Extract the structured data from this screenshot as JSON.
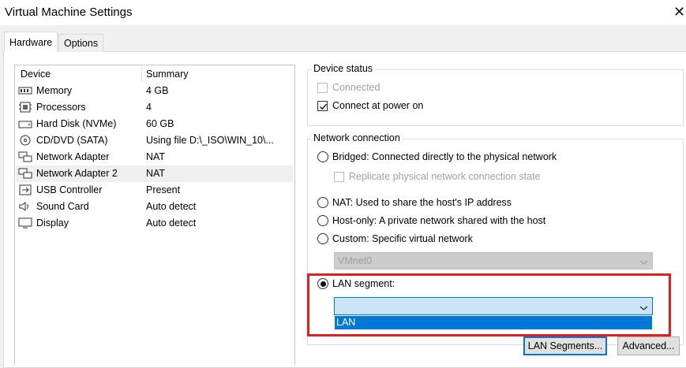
{
  "window": {
    "title": "Virtual Machine Settings",
    "close_glyph": "✕"
  },
  "tabs": [
    {
      "label": "Hardware",
      "active": true
    },
    {
      "label": "Options",
      "active": false
    }
  ],
  "device_list": {
    "headers": {
      "device": "Device",
      "summary": "Summary"
    },
    "items": [
      {
        "device": "Memory",
        "summary": "4 GB",
        "icon": "memory-icon"
      },
      {
        "device": "Processors",
        "summary": "4",
        "icon": "processor-icon"
      },
      {
        "device": "Hard Disk (NVMe)",
        "summary": "60 GB",
        "icon": "hard-disk-icon"
      },
      {
        "device": "CD/DVD (SATA)",
        "summary": "Using file D:\\_ISO\\WIN_10\\...",
        "icon": "cd-dvd-icon"
      },
      {
        "device": "Network Adapter",
        "summary": "NAT",
        "icon": "network-adapter-icon"
      },
      {
        "device": "Network Adapter 2",
        "summary": "NAT",
        "icon": "network-adapter-icon",
        "selected": true
      },
      {
        "device": "USB Controller",
        "summary": "Present",
        "icon": "usb-icon"
      },
      {
        "device": "Sound Card",
        "summary": "Auto detect",
        "icon": "speaker-icon"
      },
      {
        "device": "Display",
        "summary": "Auto detect",
        "icon": "monitor-icon"
      }
    ]
  },
  "device_status": {
    "title": "Device status",
    "connected": {
      "label": "Connected",
      "checked": false,
      "enabled": false
    },
    "connect_at_power_on": {
      "label": "Connect at power on",
      "checked": true,
      "enabled": true
    }
  },
  "network_connection": {
    "title": "Network connection",
    "bridged": {
      "label": "Bridged: Connected directly to the physical network",
      "selected": false
    },
    "replicate": {
      "label": "Replicate physical network connection state",
      "checked": false,
      "enabled": false
    },
    "nat": {
      "label": "NAT: Used to share the host's IP address",
      "selected": false
    },
    "host_only": {
      "label": "Host-only: A private network shared with the host",
      "selected": false
    },
    "custom": {
      "label": "Custom: Specific virtual network",
      "selected": false
    },
    "vmnet_select": {
      "value": "VMnet0",
      "enabled": false
    },
    "lan_segment": {
      "label": "LAN segment:",
      "selected": true
    },
    "lan_select": {
      "value": "",
      "options": [
        "LAN"
      ],
      "highlighted_option": "LAN"
    }
  },
  "buttons": {
    "lan_segments": "LAN Segments...",
    "advanced": "Advanced..."
  },
  "colors": {
    "highlight": "#0078d7",
    "annotation_red": "#e02020",
    "combo_focus_bg": "#cce4f7"
  }
}
